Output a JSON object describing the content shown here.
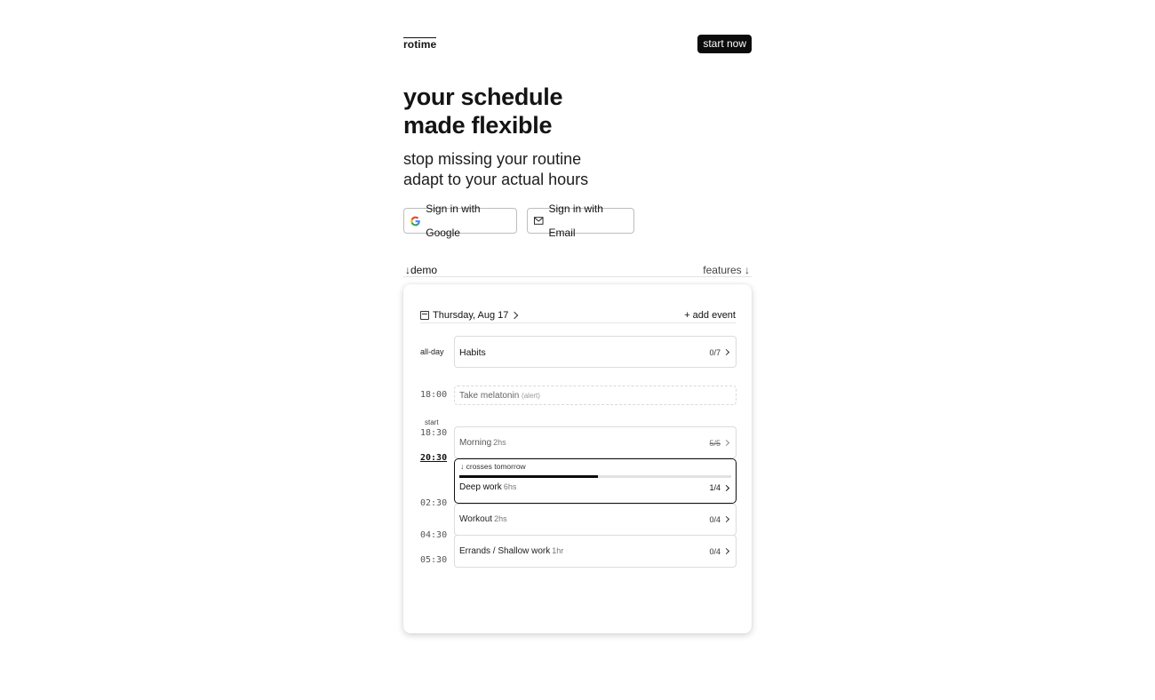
{
  "header": {
    "logo": "rotime",
    "cta": "start now"
  },
  "hero": {
    "title_line1": "your schedule",
    "title_line2": "made flexible",
    "subtitle_line1": "stop missing your routine",
    "subtitle_line2": "adapt to your actual hours"
  },
  "auth": {
    "google": "Sign in with Google",
    "email": "Sign in with Email"
  },
  "nav": {
    "demo": "↓demo",
    "features": "features ↓"
  },
  "demo": {
    "date": "Thursday, Aug 17",
    "add_event": "+ add event",
    "allday_label": "all-day",
    "start_label": "start",
    "times": {
      "t1800": "18:00",
      "t1830": "18:30",
      "t2030": "20:30",
      "t0230": "02:30",
      "t0430": "04:30",
      "t0530": "05:30"
    },
    "habits": {
      "name": "Habits",
      "count": "0/7"
    },
    "melatonin": {
      "name": "Take melatonin",
      "note": "(alert)"
    },
    "morning": {
      "name": "Morning",
      "duration": "2hs",
      "count": "5/5"
    },
    "deep_work": {
      "banner": "↓ crosses tomorrow",
      "name": "Deep work",
      "duration": "6hs",
      "count": "1/4",
      "progress": 0.51
    },
    "workout": {
      "name": "Workout",
      "duration": "2hs",
      "count": "0/4"
    },
    "errands": {
      "name": "Errands / Shallow work",
      "duration": "1hr",
      "count": "0/4"
    }
  }
}
